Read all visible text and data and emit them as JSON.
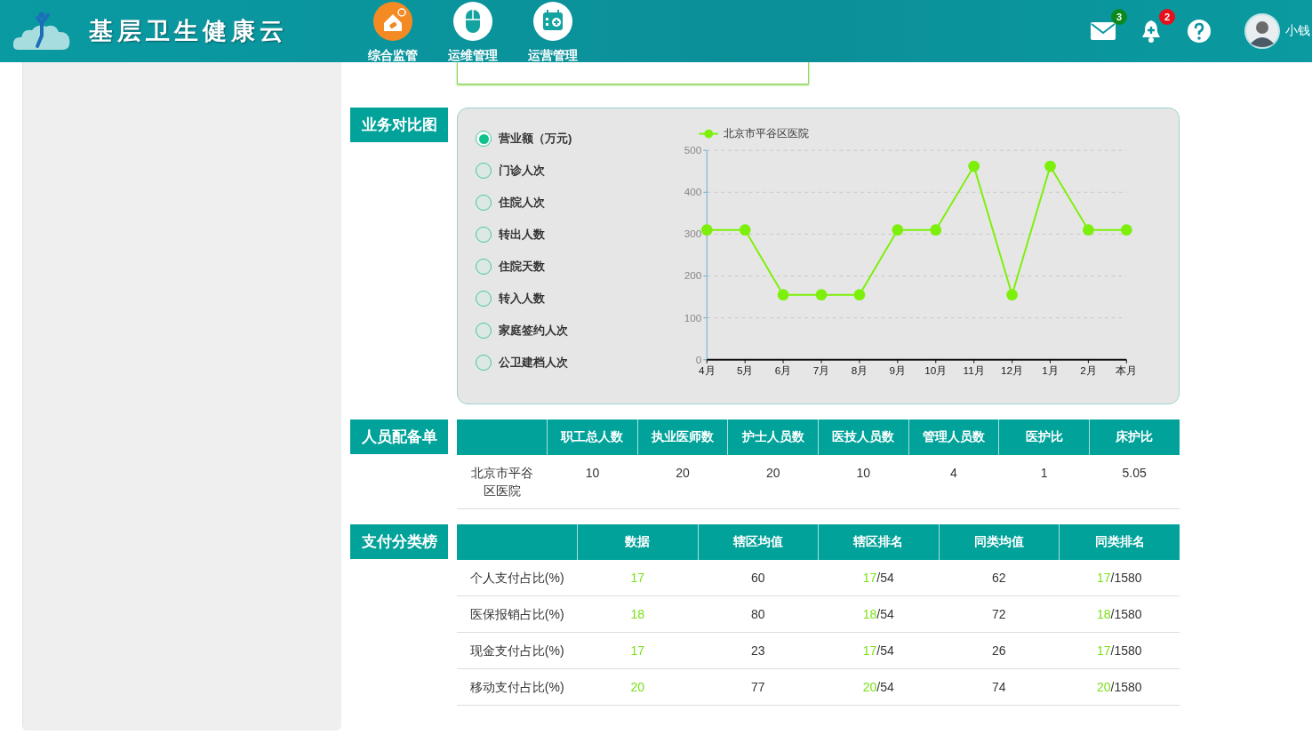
{
  "header": {
    "title": "基层卫生健康云",
    "nav": [
      {
        "label": "综合监管",
        "selected": true,
        "kind": "house"
      },
      {
        "label": "运维管理",
        "selected": false,
        "kind": "mouse"
      },
      {
        "label": "运营管理",
        "selected": false,
        "kind": "calendar"
      }
    ],
    "mail_count": "3",
    "alert_count": "2",
    "user": "小钱"
  },
  "business": {
    "title": "业务对比图",
    "options": [
      {
        "label": "营业额（万元)",
        "selected": true
      },
      {
        "label": "门诊人次",
        "selected": false
      },
      {
        "label": "住院人次",
        "selected": false
      },
      {
        "label": "转出人数",
        "selected": false
      },
      {
        "label": "住院天数",
        "selected": false
      },
      {
        "label": "转入人数",
        "selected": false
      },
      {
        "label": "家庭签约人次",
        "selected": false
      },
      {
        "label": "公卫建档人次",
        "selected": false
      }
    ],
    "chart_data": {
      "type": "line",
      "categories": [
        "4月",
        "5月",
        "6月",
        "7月",
        "8月",
        "9月",
        "10月",
        "11月",
        "12月",
        "1月",
        "2月",
        "本月"
      ],
      "grid": true,
      "series": [
        {
          "name": "北京市平谷区医院",
          "color": "#7cf00a",
          "marker": "circle",
          "values": [
            310,
            310,
            155,
            155,
            155,
            310,
            310,
            462,
            155,
            462,
            310,
            310
          ]
        }
      ],
      "ylim": [
        0,
        500
      ],
      "yticks": [
        0,
        100,
        200,
        300,
        400,
        500
      ]
    }
  },
  "staff": {
    "title": "人员配备单",
    "columns": [
      "职工总人数",
      "执业医师数",
      "护士人员数",
      "医技人员数",
      "管理人员数",
      "医护比",
      "床护比"
    ],
    "rows": [
      {
        "name": "北京市平谷区医院",
        "values": [
          "10",
          "20",
          "20",
          "10",
          "4",
          "1",
          "5.05"
        ]
      }
    ]
  },
  "payment": {
    "title": "支付分类榜",
    "columns": [
      "数据",
      "辖区均值",
      "辖区排名",
      "同类均值",
      "同类排名"
    ],
    "rows": [
      {
        "name": "个人支付占比(%)",
        "data": "17",
        "district_avg": "60",
        "district_rank": {
          "value": "17",
          "total": "/54"
        },
        "peer_avg": "62",
        "peer_rank": {
          "value": "17",
          "total": "/1580"
        }
      },
      {
        "name": "医保报销占比(%)",
        "data": "18",
        "district_avg": "80",
        "district_rank": {
          "value": "18",
          "total": "/54"
        },
        "peer_avg": "72",
        "peer_rank": {
          "value": "18",
          "total": "/1580"
        }
      },
      {
        "name": "现金支付占比(%)",
        "data": "17",
        "district_avg": "23",
        "district_rank": {
          "value": "17",
          "total": "/54"
        },
        "peer_avg": "26",
        "peer_rank": {
          "value": "17",
          "total": "/1580"
        }
      },
      {
        "name": "移动支付占比(%)",
        "data": "20",
        "district_avg": "77",
        "district_rank": {
          "value": "20",
          "total": "/54"
        },
        "peer_avg": "74",
        "peer_rank": {
          "value": "20",
          "total": "/1580"
        }
      }
    ]
  }
}
